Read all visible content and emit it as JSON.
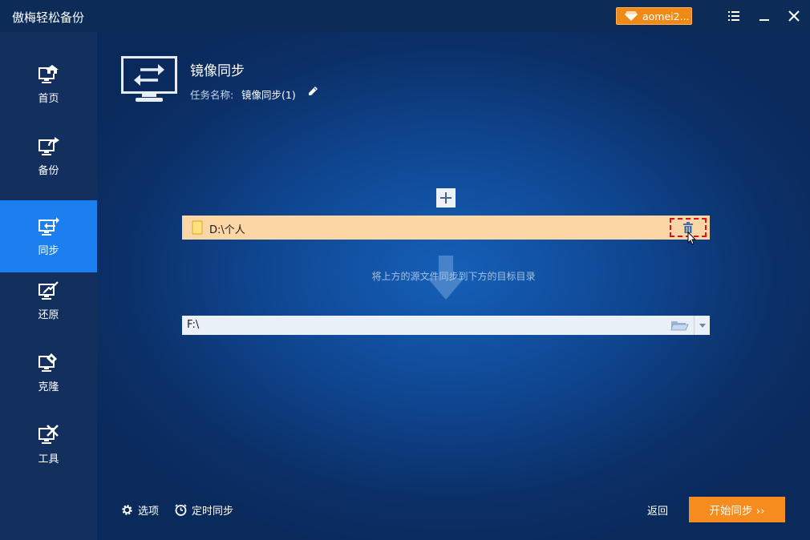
{
  "app": {
    "title": "傲梅轻松备份"
  },
  "titlebar": {
    "user_badge": "aomei2..."
  },
  "sidebar": {
    "items": [
      {
        "label": "首页",
        "icon": "home-monitor-icon",
        "active": false
      },
      {
        "label": "备份",
        "icon": "backup-monitor-icon",
        "active": false
      },
      {
        "label": "同步",
        "icon": "sync-monitor-icon",
        "active": true
      },
      {
        "label": "还原",
        "icon": "restore-monitor-icon",
        "active": false
      },
      {
        "label": "克隆",
        "icon": "clone-monitor-icon",
        "active": false
      },
      {
        "label": "工具",
        "icon": "tools-monitor-icon",
        "active": false
      }
    ]
  },
  "page": {
    "title": "镜像同步",
    "task_name_label": "任务名称:",
    "task_name_value": "镜像同步(1)"
  },
  "source": {
    "path": "D:\\个人"
  },
  "hint": "将上方的源文件同步到下方的目标目录",
  "target": {
    "path": "F:\\"
  },
  "footer": {
    "options_label": "选项",
    "schedule_label": "定时同步",
    "back_label": "返回",
    "start_label": "开始同步 ››"
  },
  "colors": {
    "accent_orange": "#f68b1e",
    "sidebar_active": "#1b7ff0",
    "source_row_bg": "#fdd6a6",
    "delete_highlight": "#e0101a"
  }
}
